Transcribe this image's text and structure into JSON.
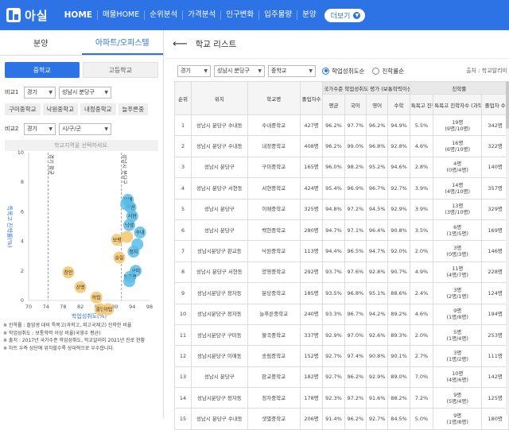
{
  "nav": {
    "logo": "아실",
    "items": [
      "HOME",
      "매물HOME",
      "순위분석",
      "가격분석",
      "인구변화",
      "입주물량",
      "분양"
    ],
    "more": "더보기"
  },
  "left": {
    "tabs": [
      "분양",
      "아파트/오피스텔"
    ],
    "school_buttons": [
      "중학교",
      "고등학교"
    ],
    "compare1": {
      "label": "비교1",
      "region": "경기",
      "district": "성남시 분당구"
    },
    "chips": [
      "구미중학교",
      "낙원중학교",
      "내정중학교",
      "늘푸른중"
    ],
    "compare2": {
      "label": "비교2",
      "region": "경기",
      "district": "시/구/군"
    },
    "hint": "학교지역을 선택하세요.",
    "legend": [
      "※ 진학률 : 졸업생 대비 특목고(과학고, 외고국제고) 진학한 비율",
      "※ 학업성취도 : 보통학력 이상 비율(국영수 평균)",
      "※ 출처 : 2017년 국가수준 학업성취도, 학교알리미 2021년 진로 현황",
      "※ 차트 우측 상단에 위치할수록 상대적으로 우수합니다."
    ]
  },
  "chart_data": {
    "type": "scatter",
    "xlabel": "학업성취도(%)",
    "ylabel": "특목고 진학률(%)",
    "xlim": [
      70,
      98
    ],
    "ylim": [
      0,
      10
    ],
    "xticks": [
      70,
      74,
      78,
      82,
      86,
      90,
      94,
      98
    ],
    "yticks": [
      0,
      2,
      4,
      6,
      8,
      10
    ],
    "ref_lines": [
      {
        "x": 74.5,
        "label": "경기 평균"
      },
      {
        "x": 91.5,
        "label": "성남시 분당구"
      }
    ],
    "colors": {
      "blue": "#5bbde8",
      "yellow": "#f5c46b"
    },
    "points": [
      {
        "x": 93.0,
        "y": 6.8,
        "label": "이매",
        "group": "blue"
      },
      {
        "x": 93.6,
        "y": 6.3,
        "label": "백현",
        "group": "blue"
      },
      {
        "x": 94.0,
        "y": 5.7,
        "label": "서현",
        "group": "blue"
      },
      {
        "x": 93.3,
        "y": 5.1,
        "label": "낙생",
        "group": "blue"
      },
      {
        "x": 92.6,
        "y": 6.5,
        "label": "",
        "group": "blue"
      },
      {
        "x": 95.8,
        "y": 4.6,
        "label": "수내",
        "group": "blue"
      },
      {
        "x": 95.2,
        "y": 3.8,
        "label": "",
        "group": "blue"
      },
      {
        "x": 94.3,
        "y": 3.3,
        "label": "정자",
        "group": "blue"
      },
      {
        "x": 94.8,
        "y": 2.0,
        "label": "구미",
        "group": "blue"
      },
      {
        "x": 93.5,
        "y": 1.6,
        "label": "늘푸른",
        "group": "blue"
      },
      {
        "x": 93.3,
        "y": 1.3,
        "label": "",
        "group": "blue"
      },
      {
        "x": 90.5,
        "y": 4.1,
        "label": "보평",
        "group": "yellow"
      },
      {
        "x": 91.0,
        "y": 2.9,
        "label": "송림",
        "group": "yellow"
      },
      {
        "x": 92.8,
        "y": 4.3,
        "label": "",
        "group": "yellow"
      },
      {
        "x": 79.2,
        "y": 1.9,
        "label": "창안",
        "group": "yellow"
      },
      {
        "x": 82.0,
        "y": 0.9,
        "label": "산명",
        "group": "yellow"
      },
      {
        "x": 85.7,
        "y": 0.2,
        "label": "하탑",
        "group": "yellow"
      },
      {
        "x": 86.6,
        "y": -0.6,
        "label": "중앙",
        "group": "yellow"
      },
      {
        "x": 88.4,
        "y": -0.6,
        "label": "야탑",
        "group": "yellow"
      }
    ]
  },
  "right": {
    "title": "학교 리스트",
    "filters": {
      "region": "경기",
      "district": "성남시 분당구",
      "level": "중학교"
    },
    "radios": [
      "학업성취도순",
      "진학률순"
    ],
    "source": "출처 : 학교알리미",
    "headers": {
      "rank": "순위",
      "location": "위치",
      "school": "학교명",
      "grads": "졸업자수",
      "achievement": "국가수준 학업성취도 평가 (보통학력이상)",
      "avg": "평균",
      "kor": "국어",
      "eng": "영어",
      "math": "수학",
      "progress": "진학률",
      "special_rate": "특목고 진학률",
      "special_count": "특목고 진학자수 (과학고/외고국제고)",
      "grads_count": "졸업자 수"
    },
    "rows": [
      [
        "1",
        "성남시 분당구 수내동",
        "수내중학교",
        "427명",
        "96.2%",
        "97.7%",
        "96.2%",
        "94.9%",
        "5.5%",
        "19명\n(9명/10명)",
        "342명"
      ],
      [
        "2",
        "성남시 분당구 수내동",
        "내정중학교",
        "408명",
        "96.2%",
        "99.0%",
        "96.8%",
        "92.8%",
        "4.6%",
        "16명\n(6명/10명)",
        "322명"
      ],
      [
        "3",
        "성남시 분당구",
        "구미중학교",
        "165명",
        "96.0%",
        "98.2%",
        "95.2%",
        "94.6%",
        "2.8%",
        "4명\n(0명/4명)",
        "140명"
      ],
      [
        "4",
        "성남시 분당구 서현동",
        "서현중학교",
        "424명",
        "95.4%",
        "96.9%",
        "96.7%",
        "92.7%",
        "3.9%",
        "14명\n(4명/10명)",
        "357명"
      ],
      [
        "5",
        "성남시 분당구",
        "이매중학교",
        "325명",
        "94.8%",
        "97.2%",
        "94.5%",
        "92.9%",
        "3.9%",
        "13명\n(3명/10명)",
        "329명"
      ],
      [
        "6",
        "성남시 분당구",
        "백현중학교",
        "280명",
        "94.7%",
        "97.1%",
        "96.4%",
        "90.8%",
        "3.5%",
        "6명\n(1명/5명)",
        "169명"
      ],
      [
        "7",
        "성남시분당구 판교동",
        "낙원중학교",
        "113명",
        "94.4%",
        "96.5%",
        "94.7%",
        "92.0%",
        "2.0%",
        "3명\n(0명/3명)",
        "146명"
      ],
      [
        "8",
        "성남시 분당구 서현동",
        "양영중학교",
        "292명",
        "93.7%",
        "97.6%",
        "92.8%",
        "90.7%",
        "4.9%",
        "11명\n(4명/7명)",
        "228명"
      ],
      [
        "9",
        "성남시분당구 정자동",
        "분당중학교",
        "185명",
        "93.5%",
        "96.8%",
        "95.1%",
        "88.6%",
        "2.4%",
        "3명\n(2명/1명)",
        "124명"
      ],
      [
        "10",
        "성남시분당구 정자동",
        "늘푸른중학교",
        "240명",
        "93.3%",
        "96.7%",
        "94.2%",
        "89.2%",
        "4.6%",
        "9명\n(1명/8명)",
        "194명"
      ],
      [
        "11",
        "성남시분당구 구미동",
        "불곡중학교",
        "337명",
        "92.9%",
        "97.0%",
        "92.6%",
        "89.3%",
        "2.0%",
        "5명\n(1명/4명)",
        "253명"
      ],
      [
        "12",
        "성남시분당구 이매동",
        "송림중학교",
        "152명",
        "92.7%",
        "97.4%",
        "90.8%",
        "90.1%",
        "2.7%",
        "3명\n(1명/2명)",
        "111명"
      ],
      [
        "13",
        "성남시 분당구",
        "판교중학교",
        "182명",
        "92.7%",
        "96.2%",
        "92.9%",
        "89.0%",
        "7.0%",
        "10명\n(4명/6명)",
        "142명"
      ],
      [
        "14",
        "성남시분당구 정자동",
        "정자중학교",
        "178명",
        "92.3%",
        "97.2%",
        "91.6%",
        "88.2%",
        "7.2%",
        "9명\n(5명/4명)",
        "125명"
      ],
      [
        "15",
        "성남시 분당구 수내동",
        "샛별중학교",
        "206명",
        "91.4%",
        "96.2%",
        "92.7%",
        "84.5%",
        "5.0%",
        "9명\n(1명/8명)",
        "180명"
      ]
    ]
  }
}
